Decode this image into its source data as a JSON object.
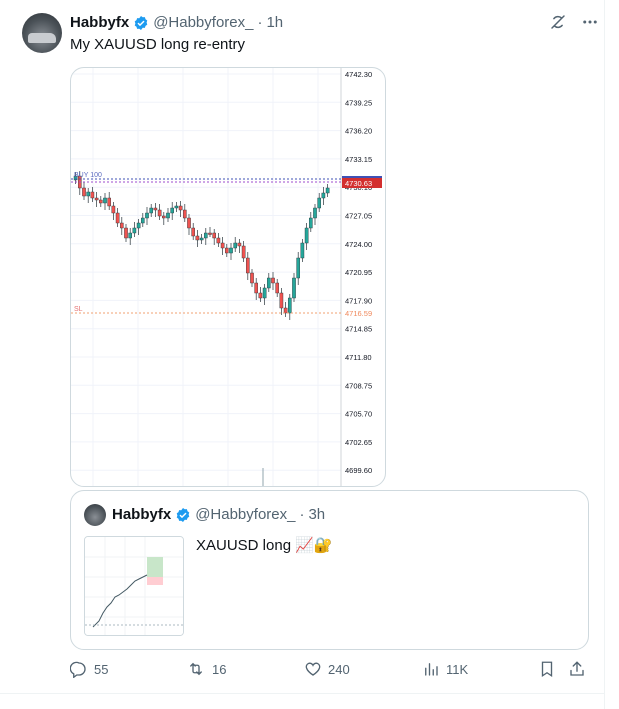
{
  "tweet": {
    "author_name": "Habbyfx",
    "handle": "@Habbyforex_",
    "separator": "·",
    "time": "1h",
    "text": "My XAUUSD long re-entry"
  },
  "chart": {
    "price_labels": [
      "4742.30",
      "4739.25",
      "4736.20",
      "4733.15",
      "4730.10",
      "4727.05",
      "4724.00",
      "4720.95",
      "4717.90",
      "4714.85",
      "4711.80",
      "4708.75",
      "4705.70",
      "4702.65",
      "4699.60"
    ],
    "current_price": "4730.63",
    "buy_label": "BUY 100",
    "sl_label": "SL",
    "sl_price": "4716.59",
    "colors": {
      "up": "#26a69a",
      "down": "#ef5350",
      "sl": "#f0a070",
      "buy_line": "#3f51b5",
      "current_bg": "#d32f2f"
    }
  },
  "quote": {
    "author_name": "Habbyfx",
    "handle": "@Habbyforex_",
    "separator": "·",
    "time": "3h",
    "text": "XAUUSD long 📈🔐"
  },
  "actions": {
    "replies": "55",
    "reposts": "16",
    "likes": "240",
    "views": "11K"
  },
  "icons": [
    "verified-icon",
    "grok-icon",
    "more-icon",
    "reply-icon",
    "repost-icon",
    "like-icon",
    "views-icon",
    "bookmark-icon",
    "share-icon"
  ]
}
